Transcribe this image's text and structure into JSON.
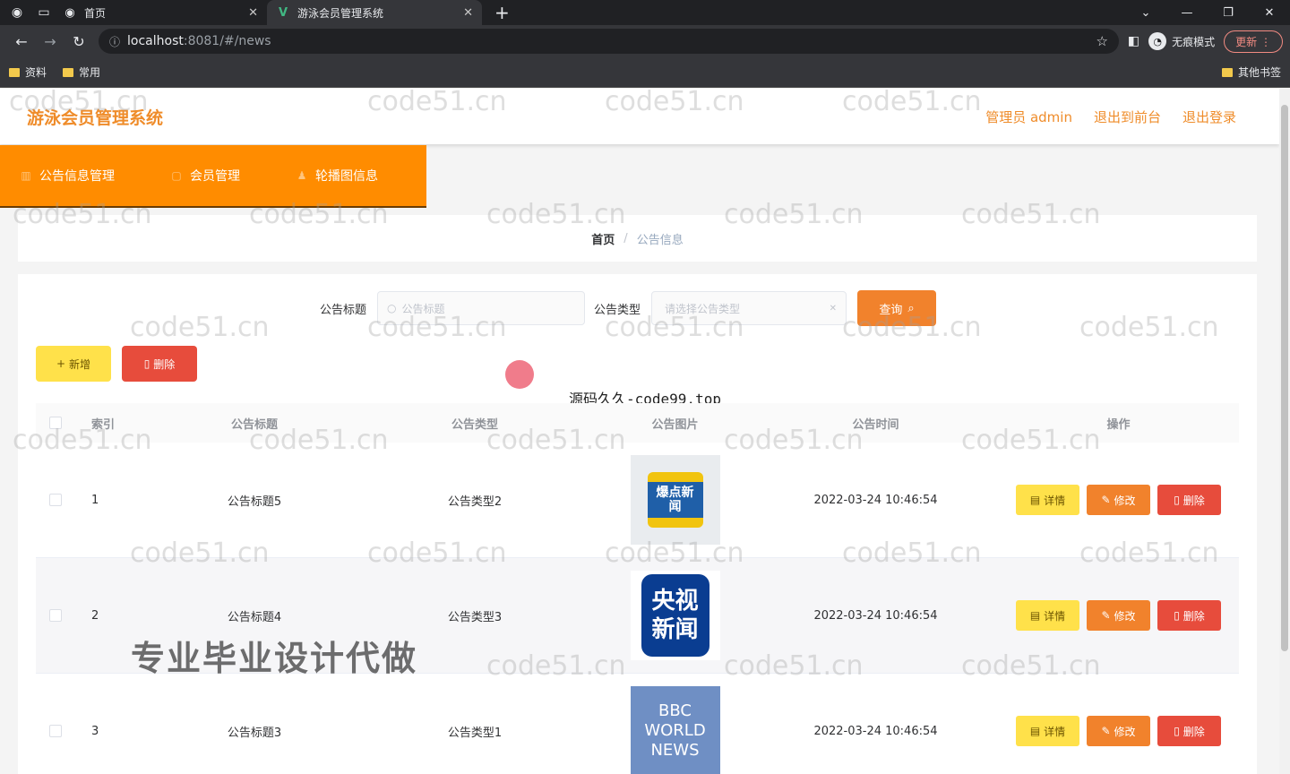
{
  "browser": {
    "tabs": [
      {
        "title": "首页",
        "active": false
      },
      {
        "title": "游泳会员管理系统",
        "active": true
      }
    ],
    "url_host": "localhost",
    "url_rest": ":8081/#/news",
    "incognito_label": "无痕模式",
    "update_label": "更新",
    "bookmarks": [
      "资料",
      "常用"
    ],
    "other_bookmarks": "其他书签"
  },
  "app": {
    "brand": "游泳会员管理系统",
    "header_links": [
      "管理员 admin",
      "退出到前台",
      "退出登录"
    ],
    "menu": [
      "公告信息管理",
      "会员管理",
      "轮播图信息"
    ],
    "breadcrumb": {
      "home": "首页",
      "current": "公告信息"
    }
  },
  "search": {
    "title_label": "公告标题",
    "title_placeholder": "公告标题",
    "type_label": "公告类型",
    "type_placeholder": "请选择公告类型",
    "query_button": "查询"
  },
  "actions": {
    "add": "新增",
    "delete": "删除"
  },
  "table": {
    "headers": [
      "索引",
      "公告标题",
      "公告类型",
      "公告图片",
      "公告时间",
      "操作"
    ],
    "rows": [
      {
        "index": "1",
        "title": "公告标题5",
        "type": "公告类型2",
        "time": "2022-03-24 10:46:54",
        "image_text": "爆点新闻"
      },
      {
        "index": "2",
        "title": "公告标题4",
        "type": "公告类型3",
        "time": "2022-03-24 10:46:54",
        "image_text": "央视新闻"
      },
      {
        "index": "3",
        "title": "公告标题3",
        "type": "公告类型1",
        "time": "2022-03-24 10:46:54",
        "image_text": "BBC WORLD NEWS"
      }
    ],
    "op_labels": {
      "detail": "详情",
      "edit": "修改",
      "remove": "删除"
    }
  },
  "overlays": {
    "source_text": "源码久久-code99.top",
    "ad_text": "专业毕业设计代做",
    "watermark": "code51.cn"
  }
}
